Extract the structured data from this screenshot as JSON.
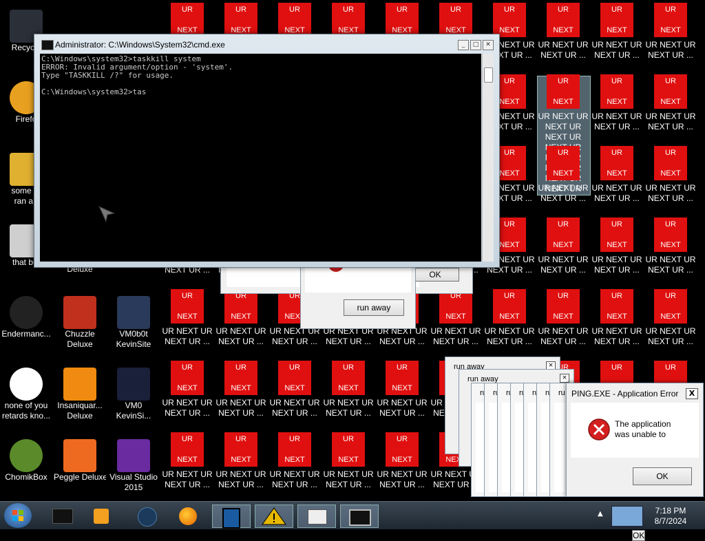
{
  "desktop": {
    "icons": [
      {
        "id": "recycle",
        "label": "Recycle",
        "l2": ""
      },
      {
        "id": "firefox",
        "label": "Firefo",
        "l2": ""
      },
      {
        "id": "some",
        "label": "some ru",
        "l2": "ran a r"
      },
      {
        "id": "that",
        "label": "that but",
        "l2": ""
      },
      {
        "id": "enderman",
        "label": "Endermanc...",
        "l2": ""
      },
      {
        "id": "chuzzle",
        "label": "Chuzzle",
        "l2": "Deluxe"
      },
      {
        "id": "vm0b0t",
        "label": "VM0b0t",
        "l2": "KevinSite"
      },
      {
        "id": "noneofyou",
        "label": "none of you",
        "l2": "retards kno..."
      },
      {
        "id": "insaniquarium",
        "label": "Insaniquar...",
        "l2": "Deluxe"
      },
      {
        "id": "vm0",
        "label": "VM0",
        "l2": "KevinSi..."
      },
      {
        "id": "chomikbox",
        "label": "ChomikBox",
        "l2": ""
      },
      {
        "id": "peggle",
        "label": "Peggle Deluxe",
        "l2": ""
      },
      {
        "id": "vstudio",
        "label": "Visual Studio",
        "l2": "2015"
      },
      {
        "id": "deluxe_partial",
        "label": "Deluxe",
        "l2": ""
      }
    ],
    "ur_icon": {
      "top_text": "UR",
      "bottom_text": "NEXT",
      "label_line1": "UR NEXT UR",
      "label_line2": "NEXT UR ..."
    },
    "selected_ur_label": "UR NEXT UR NEXT UR NEXT UR NEXT UR NEXT UR NEXT UR NEXT UR NEXT UR"
  },
  "cmd": {
    "title": "Administrator: C:\\Windows\\System32\\cmd.exe",
    "lines": [
      "C:\\Windows\\system32>taskkill system",
      "ERROR: Invalid argument/option - 'system'.",
      "Type \"TASKKILL /?\" for usage.",
      "",
      "C:\\Windows\\system32>tas"
    ]
  },
  "dialogs": {
    "ok_label": "OK",
    "run_away_label": "run away",
    "run_away_title": "run away",
    "ping": {
      "title": "PING.EXE - Application Error",
      "close": "X",
      "message_l1": "The application",
      "message_l2": "was unable to",
      "ok": "OK"
    }
  },
  "taskbar": {
    "time": "7:18 PM",
    "date": "8/7/2024",
    "overflow": "▲"
  },
  "colors": {
    "ur_red": "#e01010",
    "taskbar": "#2a3540"
  }
}
